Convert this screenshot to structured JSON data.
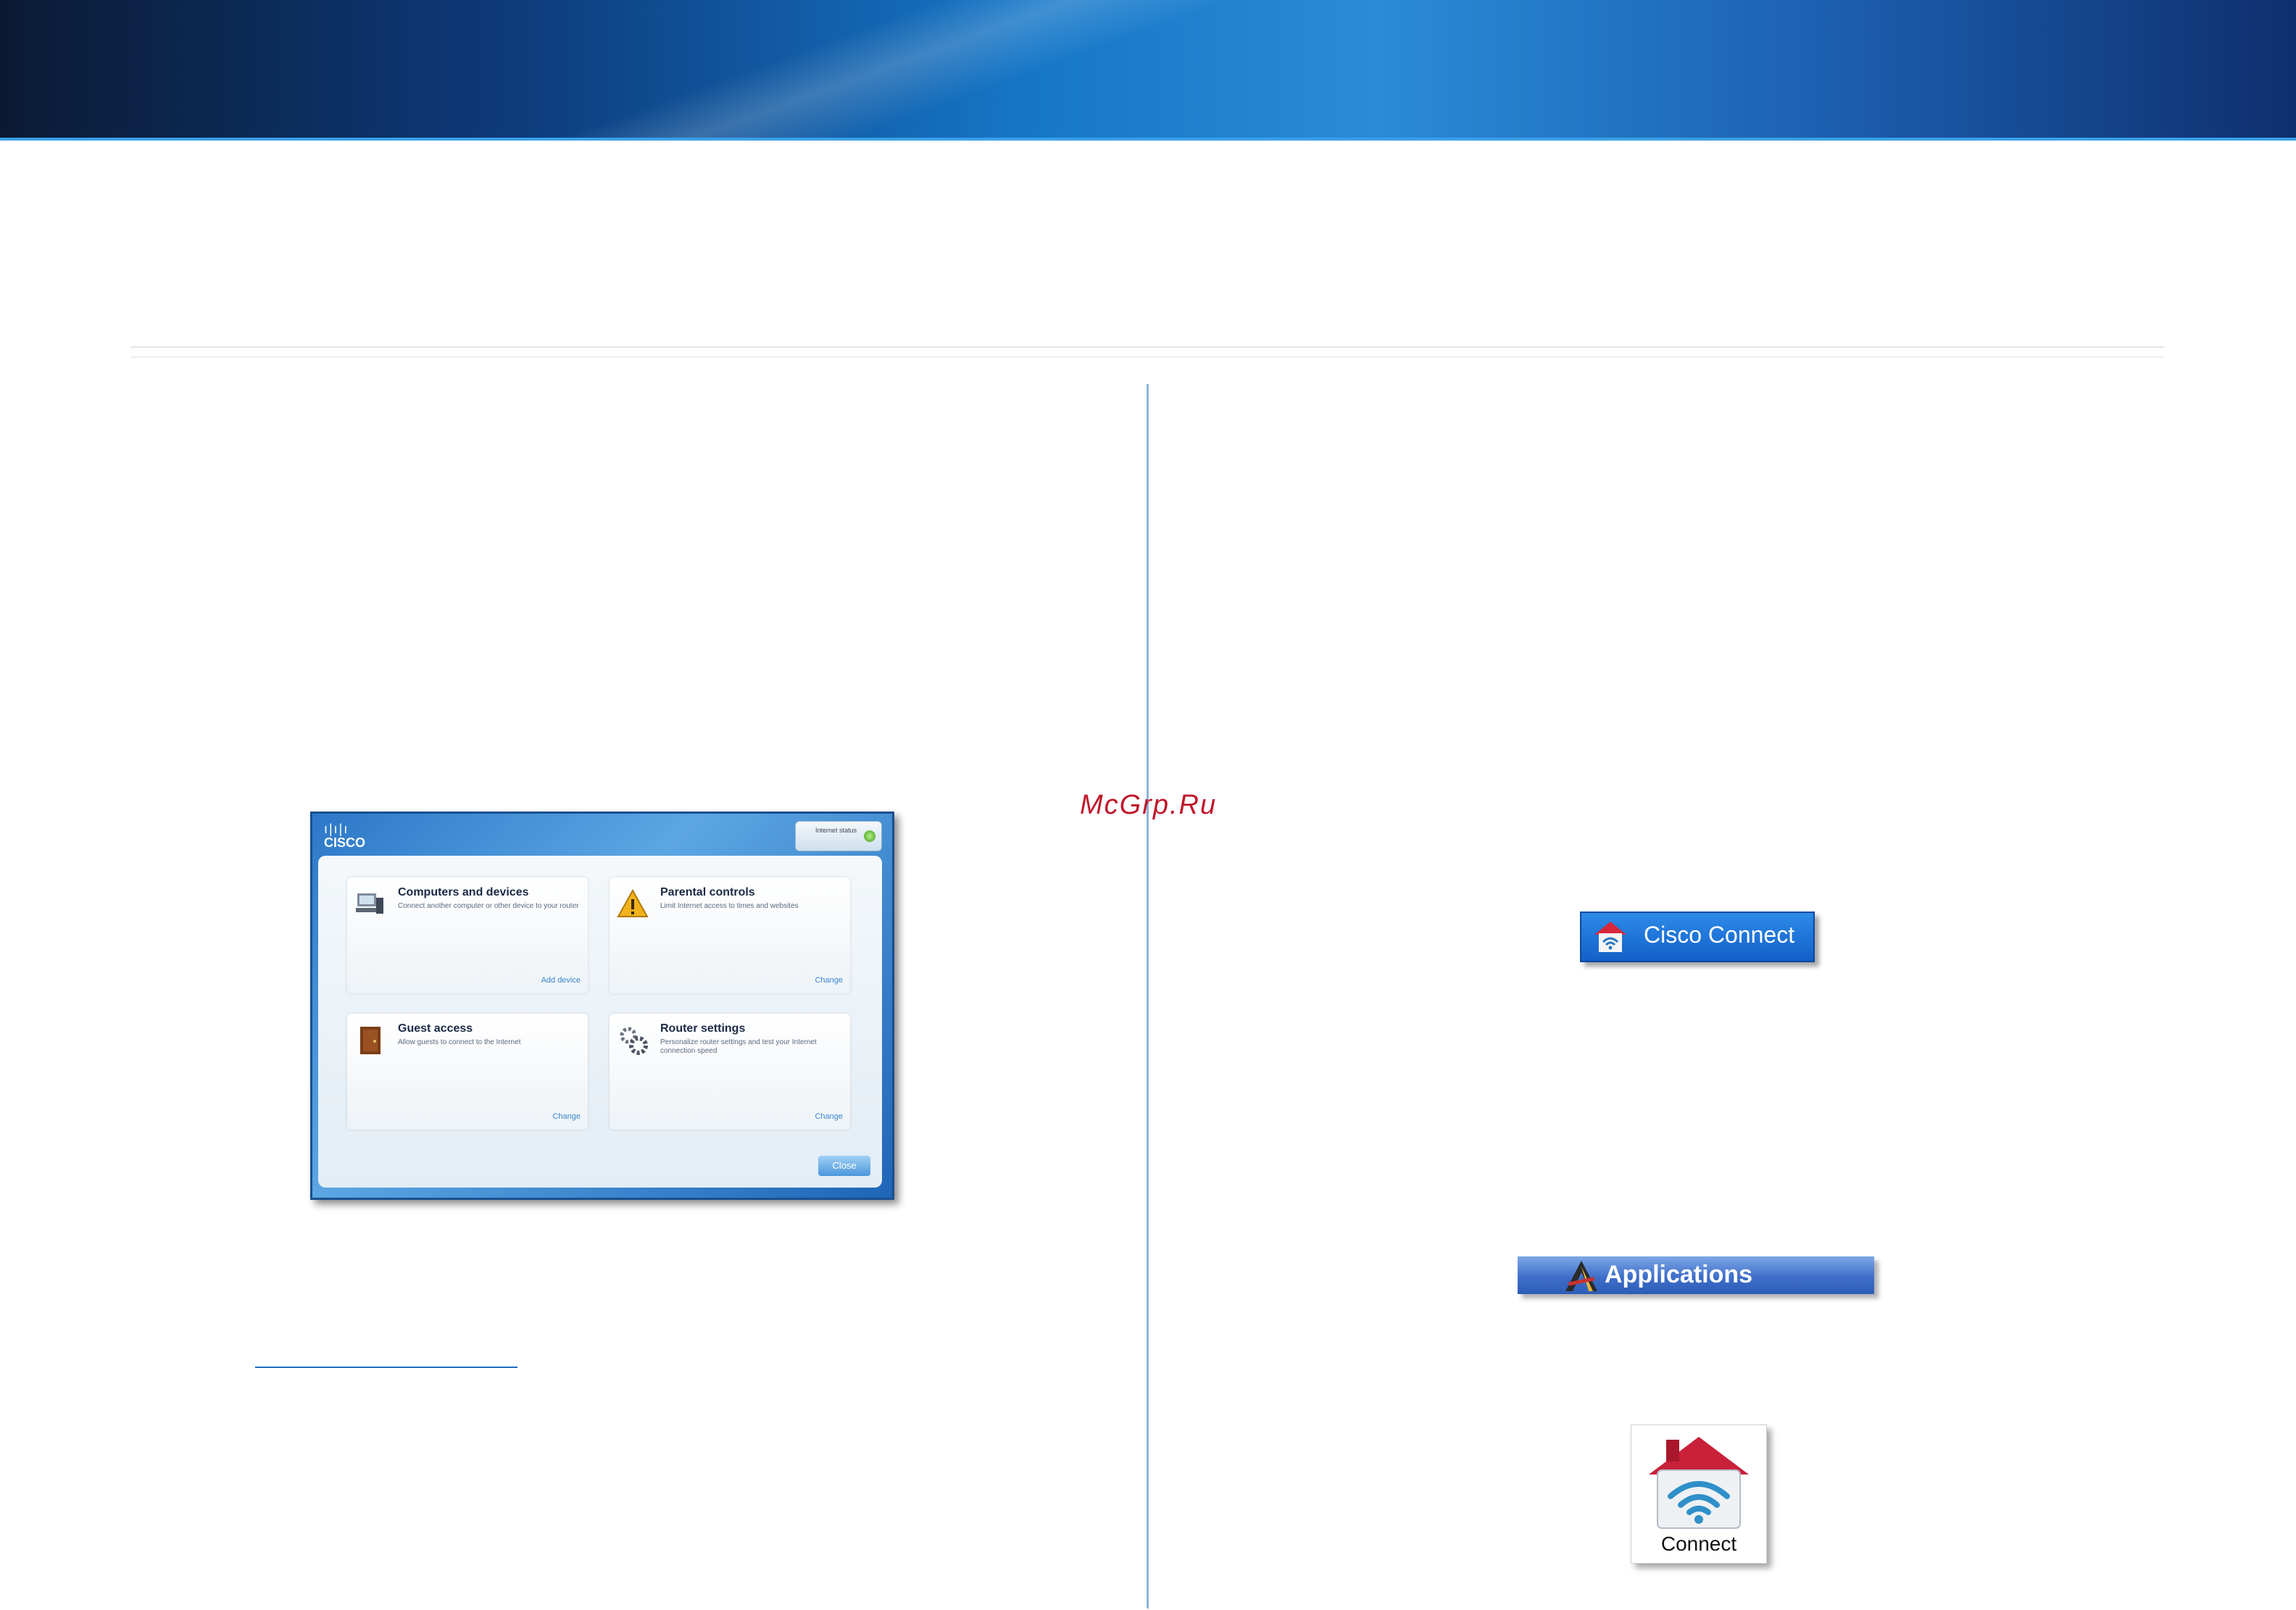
{
  "watermark": "McGrp.Ru",
  "dashboard": {
    "logo": "CISCO",
    "status_text": "Internet status",
    "tiles": [
      {
        "title": "Computers and devices",
        "desc": "Connect another computer or other device to your router",
        "link": "Add device"
      },
      {
        "title": "Parental controls",
        "desc": "Limit Internet access to times and websites",
        "link": "Change"
      },
      {
        "title": "Guest access",
        "desc": "Allow guests to connect to the Internet",
        "link": "Change"
      },
      {
        "title": "Router settings",
        "desc": "Personalize router settings and test your Internet connection speed",
        "link": "Change"
      }
    ],
    "close_label": "Close"
  },
  "cisco_connect_button": {
    "label": "Cisco Connect"
  },
  "applications_bar": {
    "label": "Applications"
  },
  "connect_icon": {
    "label": "Connect"
  },
  "colors": {
    "banner": "#1677c8",
    "divider": "#8bb3dc",
    "watermark": "#c0172a"
  }
}
